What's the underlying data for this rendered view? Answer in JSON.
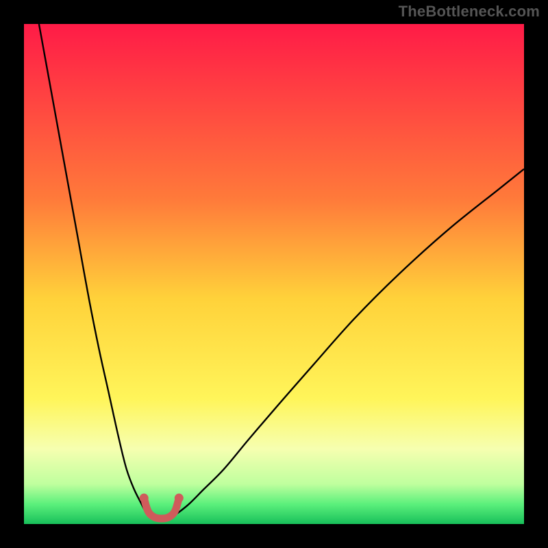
{
  "watermark": "TheBottleneck.com",
  "chart_data": {
    "type": "line",
    "title": "",
    "xlabel": "",
    "ylabel": "",
    "xlim": [
      0,
      100
    ],
    "ylim": [
      0,
      100
    ],
    "grid": false,
    "legend": false,
    "background_gradient": {
      "stops": [
        {
          "offset": 0.0,
          "color": "#ff1b47"
        },
        {
          "offset": 0.35,
          "color": "#ff7a3a"
        },
        {
          "offset": 0.55,
          "color": "#ffd23a"
        },
        {
          "offset": 0.75,
          "color": "#fff55a"
        },
        {
          "offset": 0.85,
          "color": "#f6ffb0"
        },
        {
          "offset": 0.92,
          "color": "#bfff9e"
        },
        {
          "offset": 0.96,
          "color": "#5cf07c"
        },
        {
          "offset": 1.0,
          "color": "#18c05a"
        }
      ]
    },
    "series": [
      {
        "name": "left-branch",
        "type": "line",
        "color": "#000000",
        "width": 2.4,
        "x": [
          3,
          5,
          7,
          9,
          11,
          13,
          15,
          17,
          19,
          20.5,
          22,
          23.5,
          24.5
        ],
        "y": [
          100,
          89,
          78,
          67,
          56,
          45,
          35,
          26,
          17,
          11,
          7,
          4,
          2
        ]
      },
      {
        "name": "right-branch",
        "type": "line",
        "color": "#000000",
        "width": 2.4,
        "x": [
          30.5,
          33,
          36,
          40,
          45,
          51,
          58,
          66,
          75,
          85,
          95,
          100
        ],
        "y": [
          2,
          4,
          7,
          11,
          17,
          24,
          32,
          41,
          50,
          59,
          67,
          71
        ]
      },
      {
        "name": "optimal-zone",
        "type": "line",
        "color": "#cf5b5b",
        "width": 11,
        "linecap": "round",
        "x": [
          24,
          24.8,
          26,
          27.5,
          29,
          30.2,
          31
        ],
        "y": [
          5.2,
          2.6,
          1.4,
          1.1,
          1.4,
          2.6,
          5.2
        ]
      }
    ]
  }
}
